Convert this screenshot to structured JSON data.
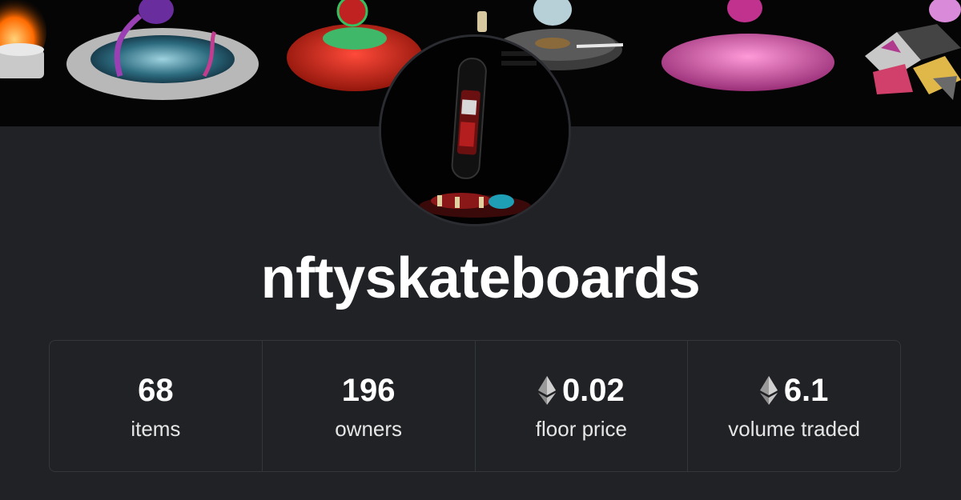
{
  "collection": {
    "name": "nftyskateboards"
  },
  "stats": [
    {
      "value": "68",
      "label": "items",
      "currency_icon": null
    },
    {
      "value": "196",
      "label": "owners",
      "currency_icon": null
    },
    {
      "value": "0.02",
      "label": "floor price",
      "currency_icon": "ethereum-icon"
    },
    {
      "value": "6.1",
      "label": "volume traded",
      "currency_icon": "ethereum-icon"
    }
  ],
  "colors": {
    "background": "#202225",
    "card_border": "#33363b",
    "text_primary": "#ffffff"
  }
}
